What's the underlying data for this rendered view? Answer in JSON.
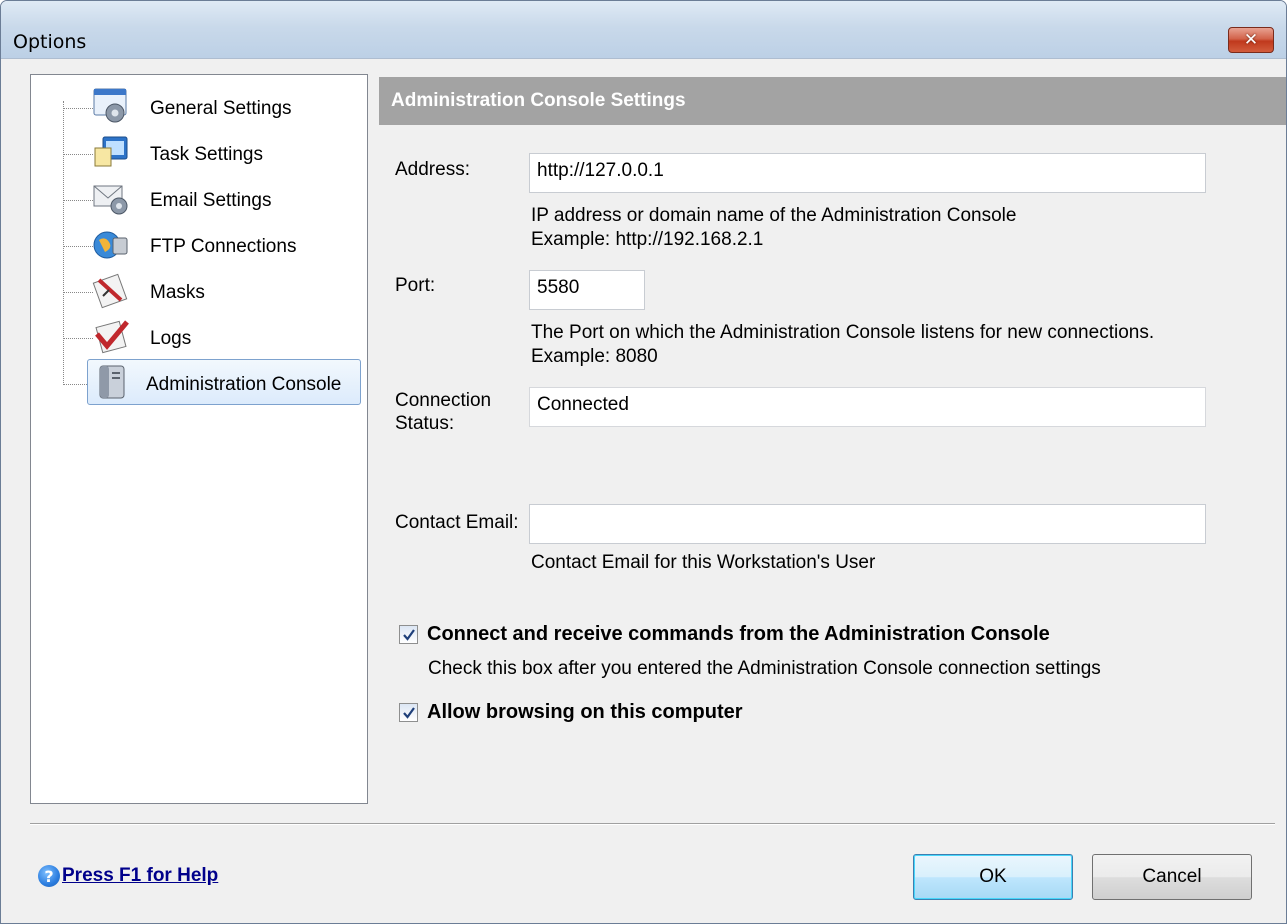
{
  "window": {
    "title": "Options",
    "close_glyph": "✕"
  },
  "tree": {
    "items": [
      {
        "label": "General Settings",
        "icon": "gear-settings-icon"
      },
      {
        "label": "Task Settings",
        "icon": "task-icon"
      },
      {
        "label": "Email Settings",
        "icon": "email-gear-icon"
      },
      {
        "label": "FTP Connections",
        "icon": "ftp-globe-icon"
      },
      {
        "label": "Masks",
        "icon": "masks-icon"
      },
      {
        "label": "Logs",
        "icon": "logs-checklist-icon"
      },
      {
        "label": "Administration Console",
        "icon": "admin-console-icon",
        "selected": true
      }
    ]
  },
  "panel": {
    "header": "Administration Console Settings",
    "address": {
      "label": "Address:",
      "value": "http://127.0.0.1",
      "hint_line1": "IP address or domain name of the Administration Console",
      "hint_line2": "Example: http://192.168.2.1"
    },
    "port": {
      "label": "Port:",
      "value": "5580",
      "hint_line1": "The Port on which the Administration Console listens for new connections.",
      "hint_line2": "Example: 8080"
    },
    "status": {
      "label_line1": "Connection",
      "label_line2": "Status:",
      "value": "Connected"
    },
    "contact": {
      "label": "Contact Email:",
      "value": "",
      "hint": "Contact Email for this Workstation's User"
    },
    "connect_checkbox": {
      "label": "Connect and receive commands from the Administration Console",
      "checked": true,
      "hint": "Check this box after you entered the Administration Console connection settings"
    },
    "browse_checkbox": {
      "label": "Allow browsing on this computer",
      "checked": true
    }
  },
  "footer": {
    "help_glyph": "?",
    "help_link": "Press F1 for Help",
    "ok_label": "OK",
    "cancel_label": "Cancel"
  }
}
